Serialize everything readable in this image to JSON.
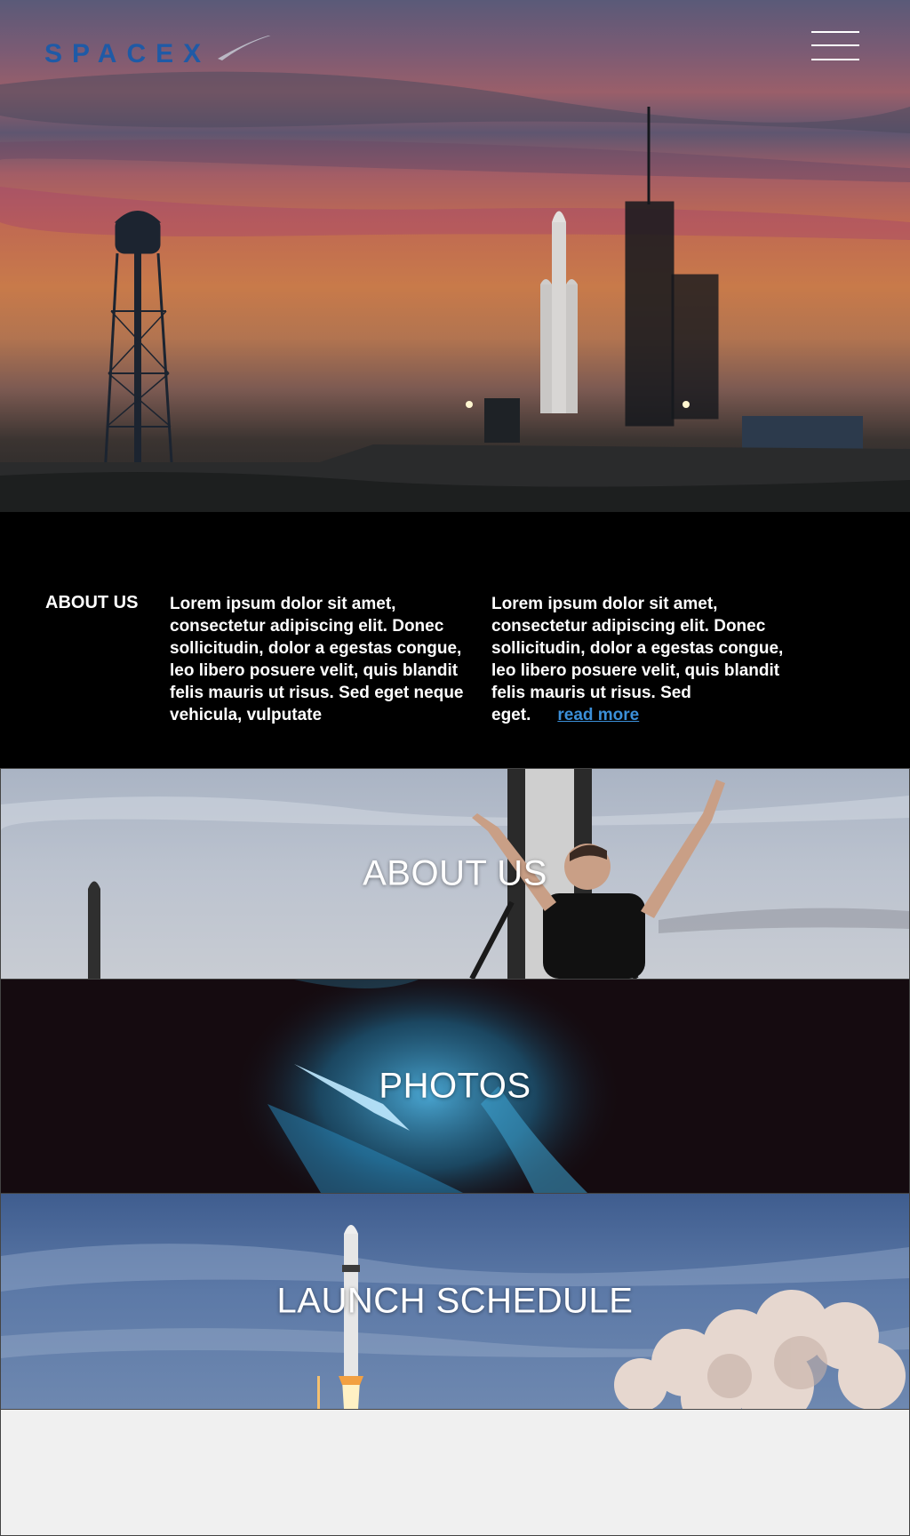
{
  "header": {
    "logo_text": "SPACEX",
    "menu_icon": "hamburger-menu-icon"
  },
  "about_section": {
    "heading": "ABOUT US",
    "column_1": "Lorem ipsum dolor sit amet, consectetur adipiscing elit. Donec sollicitudin, dolor a egestas congue, leo libero posuere velit, quis blandit felis mauris ut risus. Sed eget neque vehicula, vulputate",
    "column_2": "Lorem ipsum dolor sit amet, consectetur adipiscing elit. Donec sollicitudin, dolor a egestas congue, leo libero posuere velit, quis blandit felis mauris ut risus. Sed eget.",
    "read_more": "read more"
  },
  "banners": [
    {
      "label": "ABOUT US"
    },
    {
      "label": "PHOTOS"
    },
    {
      "label": "LAUNCH SCHEDULE"
    }
  ],
  "colors": {
    "logo_blue": "#1f5aa6",
    "link_blue": "#3b8fd8",
    "section_black": "#000000",
    "footer_gray": "#f0f0f0"
  }
}
